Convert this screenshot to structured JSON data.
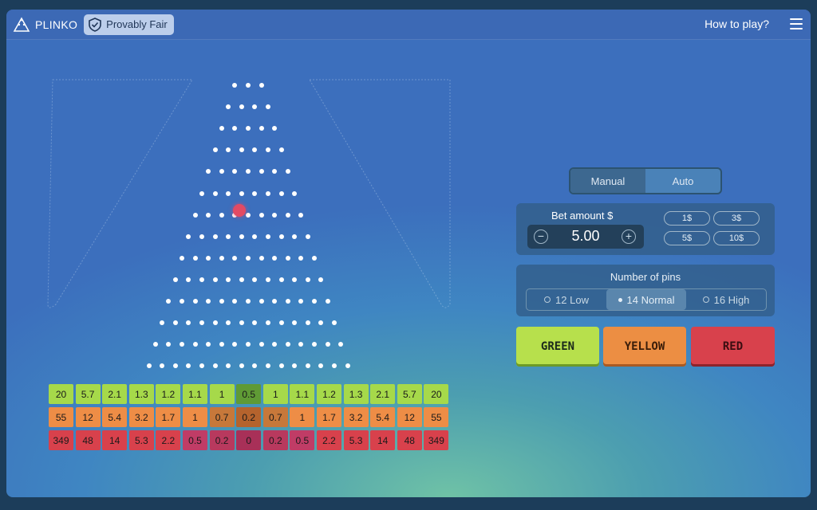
{
  "header": {
    "logo_text": "PLINKO",
    "provably_fair_label": "Provably Fair",
    "how_to_play_label": "How to play?"
  },
  "mode_tabs": {
    "manual_label": "Manual",
    "auto_label": "Auto",
    "active": "Manual"
  },
  "bet": {
    "label": "Bet amount $",
    "value": "5.00",
    "minus_symbol": "−",
    "plus_symbol": "+",
    "chips": [
      "1$",
      "3$",
      "5$",
      "10$"
    ]
  },
  "pins": {
    "label": "Number of pins",
    "options": [
      "12 Low",
      "14 Normal",
      "16 High"
    ],
    "selected": "14 Normal"
  },
  "risk_buttons": {
    "green": "GREEN",
    "yellow": "YELLOW",
    "red": "RED"
  },
  "board": {
    "rows": 14,
    "top_row_pins": 3
  },
  "multipliers": {
    "green": [
      "20",
      "5.7",
      "2.1",
      "1.3",
      "1.2",
      "1.1",
      "1",
      "0.5",
      "1",
      "1.1",
      "1.2",
      "1.3",
      "2.1",
      "5.7",
      "20"
    ],
    "yellow": [
      "55",
      "12",
      "5.4",
      "3.2",
      "1.7",
      "1",
      "0.7",
      "0.2",
      "0.7",
      "1",
      "1.7",
      "3.2",
      "5.4",
      "12",
      "55"
    ],
    "red": [
      "349",
      "48",
      "14",
      "5.3",
      "2.2",
      "0.5",
      "0.2",
      "0",
      "0.2",
      "0.5",
      "2.2",
      "5.3",
      "14",
      "48",
      "349"
    ]
  },
  "colors": {
    "green_row": [
      "#a6d94a",
      "#a6d94a",
      "#a6d94a",
      "#a6d94a",
      "#a6d94a",
      "#a6d94a",
      "#a6d94a",
      "#5f9a35",
      "#a6d94a",
      "#a6d94a",
      "#a6d94a",
      "#a6d94a",
      "#a6d94a",
      "#a6d94a",
      "#a6d94a"
    ],
    "yellow_row": [
      "#ee8d46",
      "#ee8d46",
      "#ee8d46",
      "#ee8d46",
      "#ee8d46",
      "#ee8d46",
      "#c7783a",
      "#b5632d",
      "#c7783a",
      "#ee8d46",
      "#ee8d46",
      "#ee8d46",
      "#ee8d46",
      "#ee8d46",
      "#ee8d46"
    ],
    "red_row": [
      "#d8414c",
      "#d8414c",
      "#d8414c",
      "#d8414c",
      "#d8414c",
      "#c03c66",
      "#b8395e",
      "#a83058",
      "#b8395e",
      "#c03c66",
      "#d8414c",
      "#d8414c",
      "#d8414c",
      "#d8414c",
      "#d8414c"
    ]
  }
}
